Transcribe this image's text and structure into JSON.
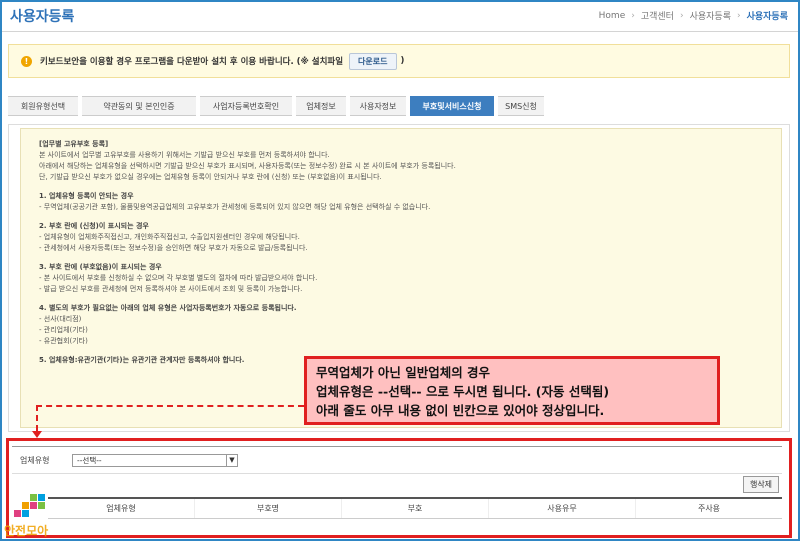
{
  "page": {
    "title": "사용자등록",
    "breadcrumb": [
      "Home",
      "고객센터",
      "사용자등록",
      "사용자등록"
    ]
  },
  "notice": {
    "text": "키보드보안을 이용할 경우 프로그램을 다운받아 설치 후 이용 바랍니다. (※ 설치파일",
    "button": "다운로드",
    "suffix": ")"
  },
  "steps": [
    {
      "label": "회원유형선택",
      "active": false
    },
    {
      "label": "약관동의 및 본인인증",
      "active": false
    },
    {
      "label": "사업자등록번호확인",
      "active": false
    },
    {
      "label": "업체정보",
      "active": false
    },
    {
      "label": "사용자정보",
      "active": false
    },
    {
      "label": "부호및서비스신청",
      "active": true
    },
    {
      "label": "SMS신청",
      "active": false
    }
  ],
  "guide": {
    "lines": [
      {
        "text": "[업무별 고유부호 등록]",
        "style": "h"
      },
      {
        "text": "본 사이트에서 업무별 고유부호를 사용하기 위해서는 기발급 받으신 부호를 먼저 등록하셔야 합니다.",
        "style": ""
      },
      {
        "text": "아래에서 해당하는 업체유형을 선택하시면 기발급 받으신 부호가 표시되며, 사용자등록(또는 정보수정) 완료 시 본 사이트에 부호가 등록됩니다.",
        "style": ""
      },
      {
        "text": "단, 기발급 받으신 부호가 없으실 경우에는 업체유형 등록이 안되거나 부호 란에 (신청) 또는 (부호없음)이 표시됩니다.",
        "style": ""
      },
      {
        "text": "",
        "style": "gap"
      },
      {
        "text": "1. 업체유형 등록이 안되는 경우",
        "style": "h"
      },
      {
        "text": "  - 무역업체(공공기관 포함), 물품및용역공급업체의 고유부호가 관세청에 등록되어 있지 않으면 해당 업체 유형은 선택하실 수 없습니다.",
        "style": ""
      },
      {
        "text": "",
        "style": "gap"
      },
      {
        "text": "2. 부호 란에 (신청)이 표시되는 경우",
        "style": "h"
      },
      {
        "text": "  - 업체유형이 업체화주직접신고, 개인화주직접신고, 수출입지원센터인 경우에 해당됩니다.",
        "style": ""
      },
      {
        "text": "  - 관세청에서 사용자등록(또는 정보수정)을 승인하면 해당 부호가 자동으로 발급/등록됩니다.",
        "style": ""
      },
      {
        "text": "",
        "style": "gap"
      },
      {
        "text": "3. 부호 란에 (부호없음)이 표시되는 경우",
        "style": "h"
      },
      {
        "text": "  - 본 사이트에서 부호를 신청하실 수 없으며 각 부호별 별도의 절차에 따라 발급받으셔야 합니다.",
        "style": ""
      },
      {
        "text": "  - 발급 받으신 부호를 관세청에 먼저 등록하셔야 본 사이트에서 조회 및 등록이 가능합니다.",
        "style": ""
      },
      {
        "text": "",
        "style": "gap"
      },
      {
        "text": "4. 별도의 부호가 필요없는 아래의 업체 유형은 사업자등록번호가 자동으로 등록됩니다.",
        "style": "h"
      },
      {
        "text": "  - 선사(대리점)",
        "style": ""
      },
      {
        "text": "  - 관리업체(기타)",
        "style": ""
      },
      {
        "text": "  - 유관협회(기타)",
        "style": ""
      },
      {
        "text": "",
        "style": "gap"
      },
      {
        "text": "5. 업체유형:유관기관(기타)는 유관기관 관계자만 등록하셔야 합니다.",
        "style": "last"
      }
    ]
  },
  "callout": {
    "line1": "무역업체가 아닌 일반업체의 경우",
    "line2": "업체유형은 --선택-- 으로 두시면 됩니다. (자동 선택됨)",
    "line3": "아래 줄도 아무 내용 없이 빈칸으로 있어야 정상입니다."
  },
  "search": {
    "label": "업체유형",
    "select_value": "--선택--",
    "delete_button": "행삭제"
  },
  "table": {
    "columns": [
      "업체유형",
      "부호명",
      "부호",
      "사용유무",
      "주사용"
    ]
  },
  "logo": {
    "text": "안전모아"
  },
  "colors": {
    "accent": "#2e72b8",
    "active_step": "#3d7ebf",
    "callout_bg": "#ffc0c0",
    "highlight_border": "#e02020",
    "notice_bg": "#fffbe1"
  }
}
